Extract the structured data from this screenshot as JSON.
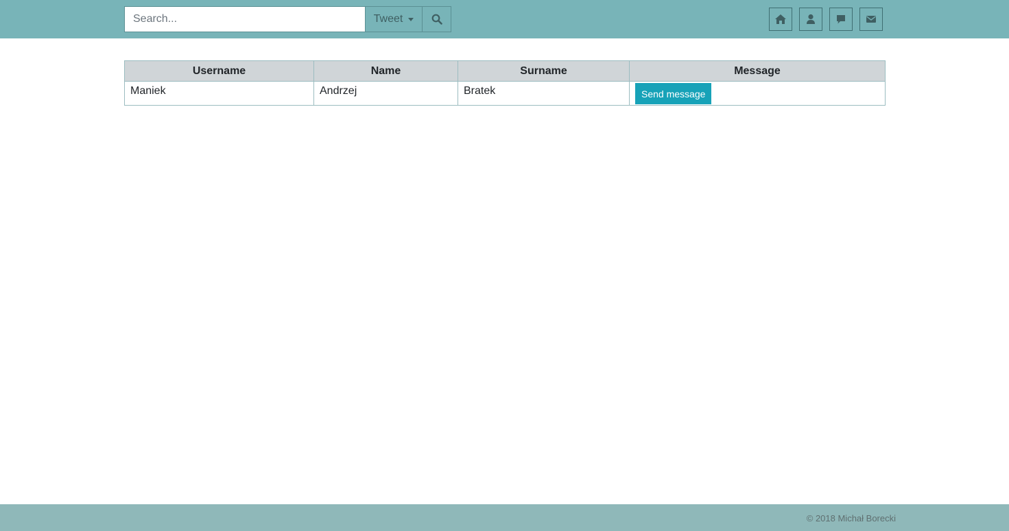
{
  "header": {
    "search": {
      "placeholder": "Search...",
      "value": ""
    },
    "tweet_dropdown": {
      "label": "Tweet"
    },
    "search_button_icon": "search-icon",
    "nav_icons": [
      "home-icon",
      "user-icon",
      "comment-icon",
      "envelope-icon"
    ],
    "colors": {
      "topbar": "#78b4b8",
      "icon": "#3f5f62"
    }
  },
  "table": {
    "columns": [
      "Username",
      "Name",
      "Surname",
      "Message"
    ],
    "rows": [
      {
        "username": "Maniek",
        "name": "Andrzej",
        "surname": "Bratek",
        "action_label": "Send message"
      }
    ],
    "colors": {
      "header_bg": "#d0d5d8",
      "button_bg": "#17a2b8"
    }
  },
  "footer": {
    "copyright": "© 2018 Michał Borecki",
    "color": "#8fb8b9"
  }
}
